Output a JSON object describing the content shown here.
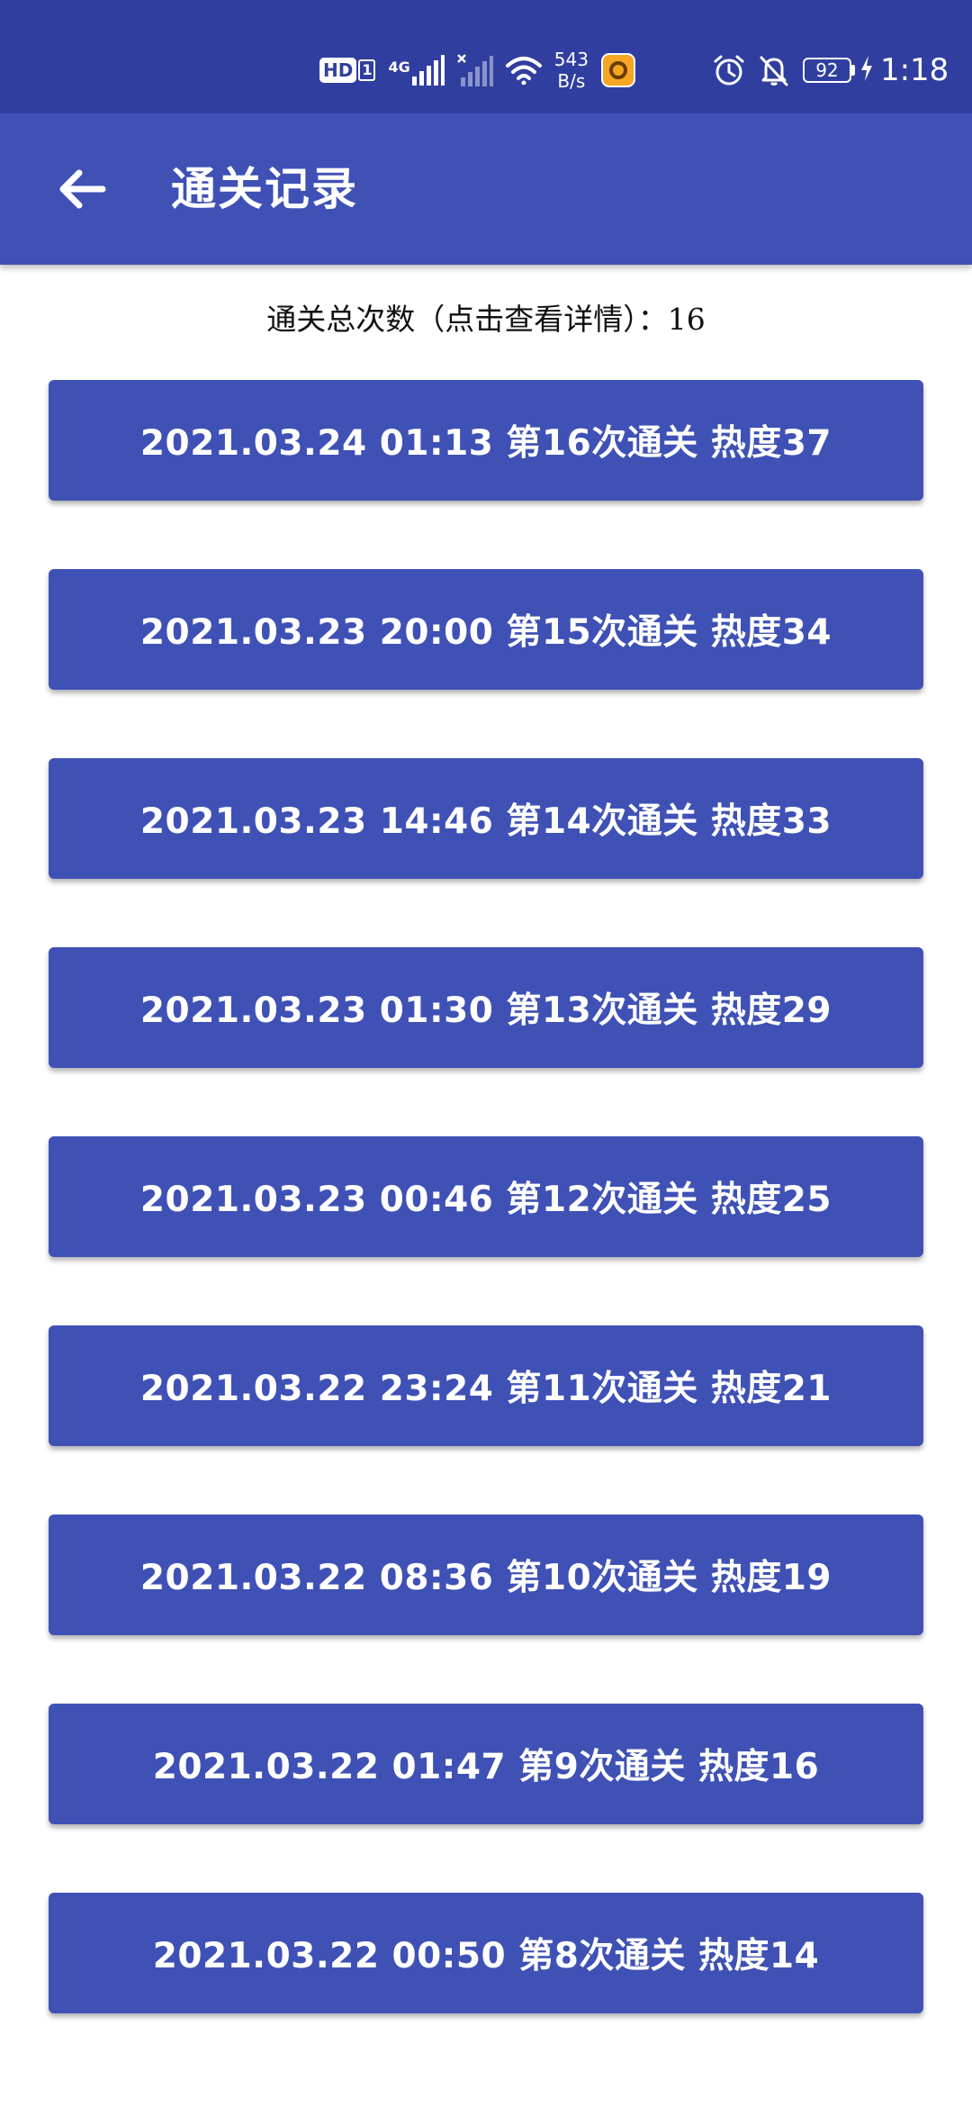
{
  "status_bar": {
    "hd_label": "HD",
    "hd_sim": "1",
    "network_label": "4G",
    "speed_value": "543",
    "speed_unit": "B/s",
    "battery_level": "92",
    "time": "1:18",
    "icons": [
      "hd-icon",
      "signal-icon",
      "no-signal-icon",
      "wifi-icon",
      "app-notification-icon",
      "alarm-icon",
      "mute-icon",
      "battery-icon",
      "charging-icon"
    ]
  },
  "app_bar": {
    "title": "通关记录",
    "back_icon": "arrow-left-icon"
  },
  "summary": {
    "text": "通关总次数（点击查看详情）：16"
  },
  "records": [
    "2021.03.24 01:13 第16次通关 热度37",
    "2021.03.23 20:00 第15次通关 热度34",
    "2021.03.23 14:46 第14次通关 热度33",
    "2021.03.23 01:30 第13次通关 热度29",
    "2021.03.23 00:46 第12次通关 热度25",
    "2021.03.22 23:24 第11次通关 热度21",
    "2021.03.22 08:36 第10次通关 热度19",
    "2021.03.22 01:47 第9次通关 热度16",
    "2021.03.22 00:50 第8次通关 热度14"
  ],
  "colors": {
    "status_bar": "#303f9f",
    "primary": "#3f51b5",
    "background": "#ffffff",
    "text_on_primary": "#ffffff"
  }
}
